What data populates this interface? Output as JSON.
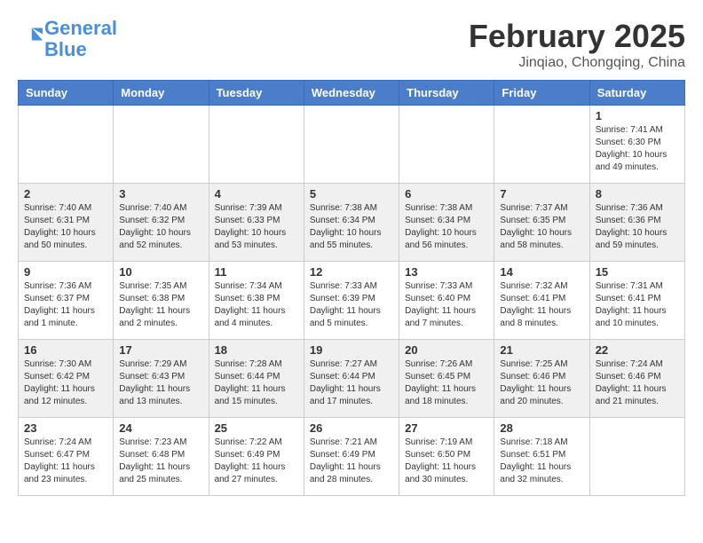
{
  "header": {
    "logo_line1": "General",
    "logo_line2": "Blue",
    "title": "February 2025",
    "subtitle": "Jinqiao, Chongqing, China"
  },
  "weekdays": [
    "Sunday",
    "Monday",
    "Tuesday",
    "Wednesday",
    "Thursday",
    "Friday",
    "Saturday"
  ],
  "weeks": [
    [
      {
        "day": "",
        "info": ""
      },
      {
        "day": "",
        "info": ""
      },
      {
        "day": "",
        "info": ""
      },
      {
        "day": "",
        "info": ""
      },
      {
        "day": "",
        "info": ""
      },
      {
        "day": "",
        "info": ""
      },
      {
        "day": "1",
        "info": "Sunrise: 7:41 AM\nSunset: 6:30 PM\nDaylight: 10 hours and 49 minutes."
      }
    ],
    [
      {
        "day": "2",
        "info": "Sunrise: 7:40 AM\nSunset: 6:31 PM\nDaylight: 10 hours and 50 minutes."
      },
      {
        "day": "3",
        "info": "Sunrise: 7:40 AM\nSunset: 6:32 PM\nDaylight: 10 hours and 52 minutes."
      },
      {
        "day": "4",
        "info": "Sunrise: 7:39 AM\nSunset: 6:33 PM\nDaylight: 10 hours and 53 minutes."
      },
      {
        "day": "5",
        "info": "Sunrise: 7:38 AM\nSunset: 6:34 PM\nDaylight: 10 hours and 55 minutes."
      },
      {
        "day": "6",
        "info": "Sunrise: 7:38 AM\nSunset: 6:34 PM\nDaylight: 10 hours and 56 minutes."
      },
      {
        "day": "7",
        "info": "Sunrise: 7:37 AM\nSunset: 6:35 PM\nDaylight: 10 hours and 58 minutes."
      },
      {
        "day": "8",
        "info": "Sunrise: 7:36 AM\nSunset: 6:36 PM\nDaylight: 10 hours and 59 minutes."
      }
    ],
    [
      {
        "day": "9",
        "info": "Sunrise: 7:36 AM\nSunset: 6:37 PM\nDaylight: 11 hours and 1 minute."
      },
      {
        "day": "10",
        "info": "Sunrise: 7:35 AM\nSunset: 6:38 PM\nDaylight: 11 hours and 2 minutes."
      },
      {
        "day": "11",
        "info": "Sunrise: 7:34 AM\nSunset: 6:38 PM\nDaylight: 11 hours and 4 minutes."
      },
      {
        "day": "12",
        "info": "Sunrise: 7:33 AM\nSunset: 6:39 PM\nDaylight: 11 hours and 5 minutes."
      },
      {
        "day": "13",
        "info": "Sunrise: 7:33 AM\nSunset: 6:40 PM\nDaylight: 11 hours and 7 minutes."
      },
      {
        "day": "14",
        "info": "Sunrise: 7:32 AM\nSunset: 6:41 PM\nDaylight: 11 hours and 8 minutes."
      },
      {
        "day": "15",
        "info": "Sunrise: 7:31 AM\nSunset: 6:41 PM\nDaylight: 11 hours and 10 minutes."
      }
    ],
    [
      {
        "day": "16",
        "info": "Sunrise: 7:30 AM\nSunset: 6:42 PM\nDaylight: 11 hours and 12 minutes."
      },
      {
        "day": "17",
        "info": "Sunrise: 7:29 AM\nSunset: 6:43 PM\nDaylight: 11 hours and 13 minutes."
      },
      {
        "day": "18",
        "info": "Sunrise: 7:28 AM\nSunset: 6:44 PM\nDaylight: 11 hours and 15 minutes."
      },
      {
        "day": "19",
        "info": "Sunrise: 7:27 AM\nSunset: 6:44 PM\nDaylight: 11 hours and 17 minutes."
      },
      {
        "day": "20",
        "info": "Sunrise: 7:26 AM\nSunset: 6:45 PM\nDaylight: 11 hours and 18 minutes."
      },
      {
        "day": "21",
        "info": "Sunrise: 7:25 AM\nSunset: 6:46 PM\nDaylight: 11 hours and 20 minutes."
      },
      {
        "day": "22",
        "info": "Sunrise: 7:24 AM\nSunset: 6:46 PM\nDaylight: 11 hours and 21 minutes."
      }
    ],
    [
      {
        "day": "23",
        "info": "Sunrise: 7:24 AM\nSunset: 6:47 PM\nDaylight: 11 hours and 23 minutes."
      },
      {
        "day": "24",
        "info": "Sunrise: 7:23 AM\nSunset: 6:48 PM\nDaylight: 11 hours and 25 minutes."
      },
      {
        "day": "25",
        "info": "Sunrise: 7:22 AM\nSunset: 6:49 PM\nDaylight: 11 hours and 27 minutes."
      },
      {
        "day": "26",
        "info": "Sunrise: 7:21 AM\nSunset: 6:49 PM\nDaylight: 11 hours and 28 minutes."
      },
      {
        "day": "27",
        "info": "Sunrise: 7:19 AM\nSunset: 6:50 PM\nDaylight: 11 hours and 30 minutes."
      },
      {
        "day": "28",
        "info": "Sunrise: 7:18 AM\nSunset: 6:51 PM\nDaylight: 11 hours and 32 minutes."
      },
      {
        "day": "",
        "info": ""
      }
    ]
  ]
}
